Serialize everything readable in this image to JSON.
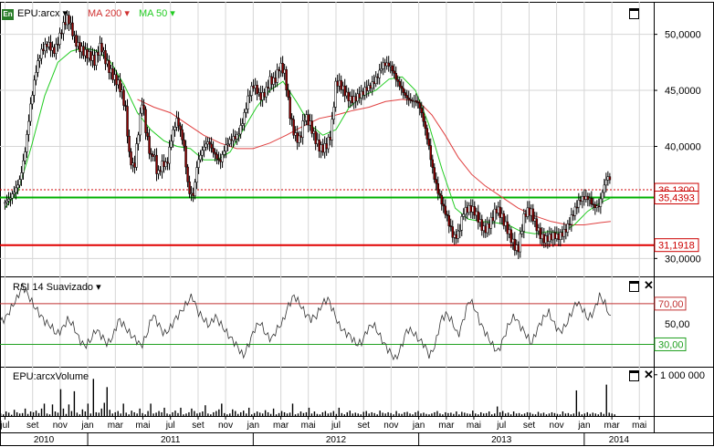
{
  "colors": {
    "price_up": "#ffffff",
    "price_down": "#8b0000",
    "ma200": "#e04040",
    "ma50": "#22cc22",
    "hline_red": "#e00000",
    "hline_green": "#00b000",
    "dotted_red": "#cc0000",
    "rsi_line": "#333333",
    "rsi_upper": "#c03030",
    "rsi_lower": "#20a020",
    "volume": "#000000",
    "grid": "#d6d6d6"
  },
  "header": {
    "symbol_label": "EPU:arcx",
    "ma200_label": "MA 200",
    "ma50_label": "MA 50",
    "dropdown_glyph": "▾",
    "logo_text": "En"
  },
  "rsi_panel": {
    "title": "RSI 14 Suavizado"
  },
  "volume_panel": {
    "title": "EPU:arcxVolume"
  },
  "chart_data": [
    {
      "type": "candlestick",
      "title": "EPU:arcx",
      "y_ticks": [
        "50,0000",
        "45,0000",
        "40,0000",
        "30,0000"
      ],
      "y_tick_values": [
        50,
        45,
        40,
        30
      ],
      "ylim": [
        28.4,
        52.9
      ],
      "value_labels": [
        {
          "text": "36,1300",
          "value": 36.13,
          "color": "#cc0000"
        },
        {
          "text": "35,4393",
          "value": 35.4393,
          "color": "#cc0000"
        },
        {
          "text": "31,1918",
          "value": 31.1918,
          "color": "#cc0000"
        }
      ],
      "horizontal_lines": [
        {
          "value": 36.13,
          "style": "dotted",
          "color": "#cc0000"
        },
        {
          "value": 35.4393,
          "style": "solid",
          "color": "#00b000"
        },
        {
          "value": 31.1918,
          "style": "solid",
          "color": "#e00000"
        }
      ],
      "price_path": [
        [
          2010.5,
          35.0
        ],
        [
          2010.53,
          34.8
        ],
        [
          2010.56,
          35.6
        ],
        [
          2010.59,
          37.2
        ],
        [
          2010.62,
          40.0
        ],
        [
          2010.65,
          43.5
        ],
        [
          2010.69,
          46.5
        ],
        [
          2010.72,
          48.0
        ],
        [
          2010.76,
          49.5
        ],
        [
          2010.8,
          49.0
        ],
        [
          2010.84,
          50.0
        ],
        [
          2010.88,
          51.0
        ],
        [
          2010.92,
          49.8
        ],
        [
          2010.96,
          49.2
        ],
        [
          2011.0,
          48.0
        ],
        [
          2011.04,
          47.0
        ],
        [
          2011.08,
          49.2
        ],
        [
          2011.12,
          47.8
        ],
        [
          2011.16,
          46.0
        ],
        [
          2011.2,
          44.5
        ],
        [
          2011.23,
          43.0
        ],
        [
          2011.25,
          39.5
        ],
        [
          2011.28,
          38.5
        ],
        [
          2011.3,
          41.0
        ],
        [
          2011.33,
          44.0
        ],
        [
          2011.35,
          41.0
        ],
        [
          2011.38,
          38.5
        ],
        [
          2011.4,
          39.5
        ],
        [
          2011.42,
          37.8
        ],
        [
          2011.45,
          39.0
        ],
        [
          2011.48,
          38.5
        ],
        [
          2011.5,
          40.0
        ],
        [
          2011.54,
          42.0
        ],
        [
          2011.58,
          40.5
        ],
        [
          2011.61,
          36.5
        ],
        [
          2011.64,
          35.8
        ],
        [
          2011.66,
          38.0
        ],
        [
          2011.69,
          39.0
        ],
        [
          2011.73,
          40.5
        ],
        [
          2011.77,
          39.8
        ],
        [
          2011.8,
          38.8
        ],
        [
          2011.83,
          39.5
        ],
        [
          2011.86,
          40.0
        ],
        [
          2011.9,
          41.0
        ],
        [
          2011.94,
          43.0
        ],
        [
          2011.97,
          44.5
        ],
        [
          2012.0,
          45.0
        ],
        [
          2012.04,
          44.0
        ],
        [
          2012.07,
          45.0
        ],
        [
          2012.1,
          46.5
        ],
        [
          2012.13,
          46.0
        ],
        [
          2012.16,
          46.8
        ],
        [
          2012.19,
          46.0
        ],
        [
          2012.22,
          43.0
        ],
        [
          2012.25,
          41.5
        ],
        [
          2012.28,
          41.0
        ],
        [
          2012.31,
          42.5
        ],
        [
          2012.34,
          41.5
        ],
        [
          2012.37,
          40.5
        ],
        [
          2012.4,
          40.2
        ],
        [
          2012.44,
          40.5
        ],
        [
          2012.47,
          41.0
        ],
        [
          2012.5,
          45.2
        ],
        [
          2012.54,
          45.0
        ],
        [
          2012.58,
          44.8
        ],
        [
          2012.62,
          44.5
        ],
        [
          2012.66,
          44.2
        ],
        [
          2012.7,
          45.0
        ],
        [
          2012.74,
          46.5
        ],
        [
          2012.78,
          47.6
        ],
        [
          2012.82,
          46.8
        ],
        [
          2012.86,
          45.8
        ],
        [
          2012.9,
          45.5
        ],
        [
          2012.93,
          44.8
        ],
        [
          2012.96,
          44.0
        ],
        [
          2013.0,
          43.2
        ],
        [
          2013.03,
          42.0
        ],
        [
          2013.06,
          40.5
        ],
        [
          2013.09,
          38.0
        ],
        [
          2013.12,
          35.8
        ],
        [
          2013.15,
          34.0
        ],
        [
          2013.18,
          32.8
        ],
        [
          2013.21,
          32.0
        ],
        [
          2013.24,
          32.8
        ],
        [
          2013.27,
          34.5
        ],
        [
          2013.31,
          34.0
        ],
        [
          2013.35,
          33.5
        ],
        [
          2013.39,
          33.0
        ],
        [
          2013.43,
          33.5
        ],
        [
          2013.47,
          34.0
        ],
        [
          2013.51,
          33.0
        ],
        [
          2013.55,
          32.5
        ],
        [
          2013.6,
          31.0
        ],
        [
          2013.64,
          33.5
        ],
        [
          2013.68,
          33.8
        ],
        [
          2013.72,
          33.0
        ],
        [
          2013.76,
          32.0
        ],
        [
          2013.8,
          31.5
        ],
        [
          2013.84,
          31.5
        ],
        [
          2013.88,
          32.8
        ],
        [
          2013.92,
          34.0
        ],
        [
          2013.96,
          34.5
        ],
        [
          2014.0,
          35.0
        ],
        [
          2014.03,
          35.5
        ],
        [
          2014.06,
          35.2
        ],
        [
          2014.09,
          35.0
        ],
        [
          2014.11,
          35.8
        ],
        [
          2014.14,
          36.8
        ],
        [
          2014.16,
          36.4
        ]
      ],
      "ma50_path": [
        [
          2010.5,
          34.5
        ],
        [
          2010.58,
          36.0
        ],
        [
          2010.66,
          40.0
        ],
        [
          2010.74,
          44.5
        ],
        [
          2010.82,
          47.5
        ],
        [
          2010.9,
          48.5
        ],
        [
          2010.98,
          48.8
        ],
        [
          2011.06,
          48.5
        ],
        [
          2011.14,
          47.5
        ],
        [
          2011.22,
          45.5
        ],
        [
          2011.3,
          43.0
        ],
        [
          2011.38,
          41.5
        ],
        [
          2011.46,
          40.5
        ],
        [
          2011.54,
          40.0
        ],
        [
          2011.62,
          39.8
        ],
        [
          2011.7,
          38.8
        ],
        [
          2011.78,
          38.8
        ],
        [
          2011.86,
          39.5
        ],
        [
          2011.94,
          41.5
        ],
        [
          2012.02,
          43.5
        ],
        [
          2012.1,
          45.0
        ],
        [
          2012.18,
          45.8
        ],
        [
          2012.26,
          44.0
        ],
        [
          2012.34,
          42.0
        ],
        [
          2012.42,
          41.0
        ],
        [
          2012.5,
          41.5
        ],
        [
          2012.58,
          43.5
        ],
        [
          2012.66,
          44.5
        ],
        [
          2012.74,
          45.0
        ],
        [
          2012.82,
          46.0
        ],
        [
          2012.9,
          46.2
        ],
        [
          2012.98,
          45.0
        ],
        [
          2013.06,
          42.0
        ],
        [
          2013.14,
          38.0
        ],
        [
          2013.22,
          34.5
        ],
        [
          2013.3,
          33.5
        ],
        [
          2013.38,
          33.3
        ],
        [
          2013.46,
          33.2
        ],
        [
          2013.54,
          33.0
        ],
        [
          2013.62,
          32.4
        ],
        [
          2013.7,
          32.2
        ],
        [
          2013.78,
          32.4
        ],
        [
          2013.86,
          32.3
        ],
        [
          2013.94,
          33.0
        ],
        [
          2014.02,
          34.2
        ],
        [
          2014.1,
          35.0
        ],
        [
          2014.16,
          35.4
        ]
      ],
      "ma200_path": [
        [
          2011.3,
          44.2
        ],
        [
          2011.4,
          43.5
        ],
        [
          2011.5,
          43.0
        ],
        [
          2011.6,
          42.0
        ],
        [
          2011.7,
          41.0
        ],
        [
          2011.8,
          40.3
        ],
        [
          2011.9,
          39.8
        ],
        [
          2012.0,
          39.8
        ],
        [
          2012.1,
          40.3
        ],
        [
          2012.2,
          41.0
        ],
        [
          2012.3,
          41.8
        ],
        [
          2012.4,
          42.5
        ],
        [
          2012.5,
          42.8
        ],
        [
          2012.6,
          43.2
        ],
        [
          2012.7,
          43.5
        ],
        [
          2012.8,
          44.0
        ],
        [
          2012.9,
          44.2
        ],
        [
          2013.0,
          44.0
        ],
        [
          2013.08,
          42.8
        ],
        [
          2013.16,
          41.0
        ],
        [
          2013.24,
          39.0
        ],
        [
          2013.32,
          37.5
        ],
        [
          2013.4,
          36.5
        ],
        [
          2013.5,
          35.5
        ],
        [
          2013.6,
          34.5
        ],
        [
          2013.7,
          33.8
        ],
        [
          2013.8,
          33.3
        ],
        [
          2013.9,
          33.0
        ],
        [
          2014.0,
          33.0
        ],
        [
          2014.1,
          33.2
        ],
        [
          2014.16,
          33.3
        ]
      ]
    },
    {
      "type": "line",
      "title": "RSI 14 Suavizado",
      "ylim": [
        8,
        95
      ],
      "reference_lines": [
        {
          "value": 70,
          "label": "70,00",
          "color": "#c03030"
        },
        {
          "value": 30,
          "label": "30,00",
          "color": "#20a020"
        }
      ],
      "tick_labels": [
        {
          "text": "50,00",
          "value": 50
        }
      ],
      "series": [
        {
          "values": [
            52,
            56,
            66,
            75,
            88,
            78,
            68,
            60,
            52,
            48,
            40,
            45,
            55,
            48,
            35,
            28,
            34,
            45,
            38,
            30,
            38,
            55,
            48,
            40,
            35,
            28,
            40,
            60,
            50,
            40,
            45,
            55,
            62,
            70,
            78,
            62,
            55,
            48,
            58,
            50,
            42,
            35,
            28,
            18,
            30,
            45,
            52,
            40,
            35,
            45,
            52,
            68,
            78,
            70,
            60,
            55,
            58,
            70,
            75,
            62,
            48,
            42,
            38,
            30,
            32,
            45,
            50,
            40,
            30,
            22,
            15,
            28,
            45,
            42,
            35,
            30,
            18,
            30,
            55,
            60,
            52,
            38,
            55,
            75,
            65,
            50,
            40,
            30,
            22,
            35,
            50,
            58,
            48,
            40,
            30,
            45,
            55,
            62,
            50,
            42,
            48,
            60,
            72,
            65,
            55,
            62,
            78,
            70,
            55
          ]
        }
      ]
    },
    {
      "type": "bar",
      "title": "EPU:arcxVolume",
      "y_ticks": [
        "1 000 000"
      ],
      "y_tick_values": [
        1000000
      ],
      "ylim": [
        0,
        1150000
      ],
      "x_start": 2010.47,
      "x_end": 2014.18,
      "values": [
        60000,
        40000,
        110000,
        80000,
        30000,
        150000,
        90000,
        60000,
        70000,
        180000,
        50000,
        110000,
        90000,
        130000,
        70000,
        180000,
        300000,
        60000,
        40000,
        280000,
        110000,
        80000,
        650000,
        180000,
        50000,
        280000,
        120000,
        600000,
        80000,
        40000,
        160000,
        110000,
        300000,
        60000,
        900000,
        90000,
        80000,
        180000,
        320000,
        700000,
        150000,
        60000,
        90000,
        120000,
        60000,
        300000,
        80000,
        40000,
        130000,
        90000,
        60000,
        180000,
        70000,
        40000,
        120000,
        300000,
        60000,
        80000,
        120000,
        90000,
        200000,
        60000,
        40000,
        90000,
        130000,
        70000,
        200000,
        40000,
        60000,
        90000,
        180000,
        120000,
        60000,
        80000,
        110000,
        260000,
        60000,
        40000,
        90000,
        120000,
        160000,
        300000,
        70000,
        40000,
        60000,
        160000,
        120000,
        50000,
        90000,
        130000,
        60000,
        200000,
        40000,
        70000,
        110000,
        80000,
        60000,
        140000,
        90000,
        50000,
        180000,
        40000,
        70000,
        120000,
        90000,
        60000,
        80000,
        300000,
        40000,
        60000,
        110000,
        70000,
        90000,
        200000,
        60000,
        110000,
        50000,
        40000,
        90000,
        120000,
        60000,
        80000,
        120000,
        50000,
        200000,
        70000,
        40000,
        90000,
        130000,
        60000,
        80000,
        60000,
        40000,
        100000,
        120000,
        60000,
        90000,
        70000,
        40000,
        130000,
        80000,
        60000,
        90000,
        70000,
        40000,
        120000,
        60000,
        50000,
        90000,
        100000,
        60000,
        40000,
        90000,
        120000,
        60000,
        80000,
        50000,
        40000,
        60000,
        90000,
        120000,
        60000,
        40000,
        90000,
        70000,
        80000,
        50000,
        110000,
        40000,
        100000,
        80000,
        60000,
        50000,
        130000,
        60000,
        40000,
        90000,
        60000,
        70000,
        110000,
        40000,
        60000,
        230000,
        90000,
        120000,
        60000,
        80000,
        40000,
        110000,
        60000,
        70000,
        40000,
        60000,
        90000,
        80000,
        50000,
        40000,
        100000,
        60000,
        80000,
        40000,
        60000,
        90000,
        70000,
        50000,
        40000,
        110000,
        60000,
        70000,
        40000,
        60000,
        620000,
        100000,
        40000,
        60000,
        90000,
        50000,
        80000,
        60000,
        40000,
        90000,
        50000,
        760000,
        80000,
        60000,
        40000
      ]
    }
  ],
  "time_axis": {
    "months": [
      {
        "label": "jul",
        "x": 2010.5
      },
      {
        "label": "set",
        "x": 2010.667
      },
      {
        "label": "nov",
        "x": 2010.833
      },
      {
        "label": "jan",
        "x": 2011.0
      },
      {
        "label": "mar",
        "x": 2011.167
      },
      {
        "label": "mai",
        "x": 2011.333
      },
      {
        "label": "jul",
        "x": 2011.5
      },
      {
        "label": "set",
        "x": 2011.667
      },
      {
        "label": "nov",
        "x": 2011.833
      },
      {
        "label": "jan",
        "x": 2012.0
      },
      {
        "label": "mar",
        "x": 2012.167
      },
      {
        "label": "mai",
        "x": 2012.333
      },
      {
        "label": "jul",
        "x": 2012.5
      },
      {
        "label": "set",
        "x": 2012.667
      },
      {
        "label": "nov",
        "x": 2012.833
      },
      {
        "label": "jan",
        "x": 2013.0
      },
      {
        "label": "mar",
        "x": 2013.167
      },
      {
        "label": "mai",
        "x": 2013.333
      },
      {
        "label": "jul",
        "x": 2013.5
      },
      {
        "label": "set",
        "x": 2013.667
      },
      {
        "label": "nov",
        "x": 2013.833
      },
      {
        "label": "jan",
        "x": 2014.0
      },
      {
        "label": "mar",
        "x": 2014.167
      },
      {
        "label": "mai",
        "x": 2014.333
      }
    ],
    "years": [
      {
        "label": "2010",
        "x": 2010.0
      },
      {
        "label": "2011",
        "x": 2011.0
      },
      {
        "label": "2012",
        "x": 2012.0
      },
      {
        "label": "2013",
        "x": 2013.0
      },
      {
        "label": "2014",
        "x": 2014.0
      }
    ],
    "x_range": [
      2010.47,
      2014.42
    ]
  }
}
